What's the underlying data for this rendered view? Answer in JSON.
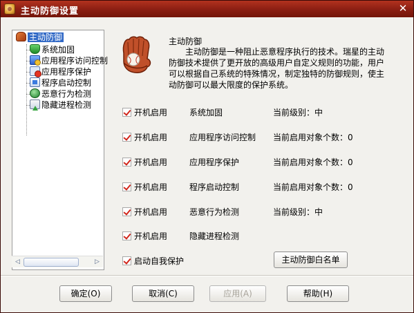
{
  "window": {
    "title": "主动防御设置",
    "close_glyph": "✕"
  },
  "tree": {
    "root": "主动防御",
    "items": [
      {
        "label": "系统加固",
        "icon": "shield-icon"
      },
      {
        "label": "应用程序访问控制",
        "icon": "access-control-icon"
      },
      {
        "label": "应用程序保护",
        "icon": "protect-icon"
      },
      {
        "label": "程序启动控制",
        "icon": "startup-control-icon"
      },
      {
        "label": "恶意行为检测",
        "icon": "malicious-behavior-icon"
      },
      {
        "label": "隐藏进程检测",
        "icon": "hidden-process-icon"
      }
    ],
    "scroll_left": "◁",
    "scroll_right": "▷"
  },
  "description": {
    "title": "主动防御",
    "text": "主动防御是一种阻止恶意程序执行的技术。瑞星的主动防御技术提供了更开放的高级用户自定义规则的功能，用户可以根据自己系统的特殊情况，制定独特的防御规则，使主动防御可以最大限度的保护系统。"
  },
  "rows": [
    {
      "enable": "开机启用",
      "feature": "系统加固",
      "status": "当前级别：中"
    },
    {
      "enable": "开机启用",
      "feature": "应用程序访问控制",
      "status": "当前启用对象个数：0"
    },
    {
      "enable": "开机启用",
      "feature": "应用程序保护",
      "status": "当前启用对象个数：0"
    },
    {
      "enable": "开机启用",
      "feature": "程序启动控制",
      "status": "当前启用对象个数：0"
    },
    {
      "enable": "开机启用",
      "feature": "恶意行为检测",
      "status": "当前级别：中"
    },
    {
      "enable": "开机启用",
      "feature": "隐藏进程检测",
      "status": ""
    }
  ],
  "self_protect": "启动自我保护",
  "whitelist_button": "主动防御白名单",
  "buttons": {
    "ok": "确定(O)",
    "cancel": "取消(C)",
    "apply": "应用(A)",
    "help": "帮助(H)"
  },
  "colors": {
    "titlebar": "#8a1e12",
    "selection": "#3169c6",
    "checkmark": "#d0251a"
  }
}
